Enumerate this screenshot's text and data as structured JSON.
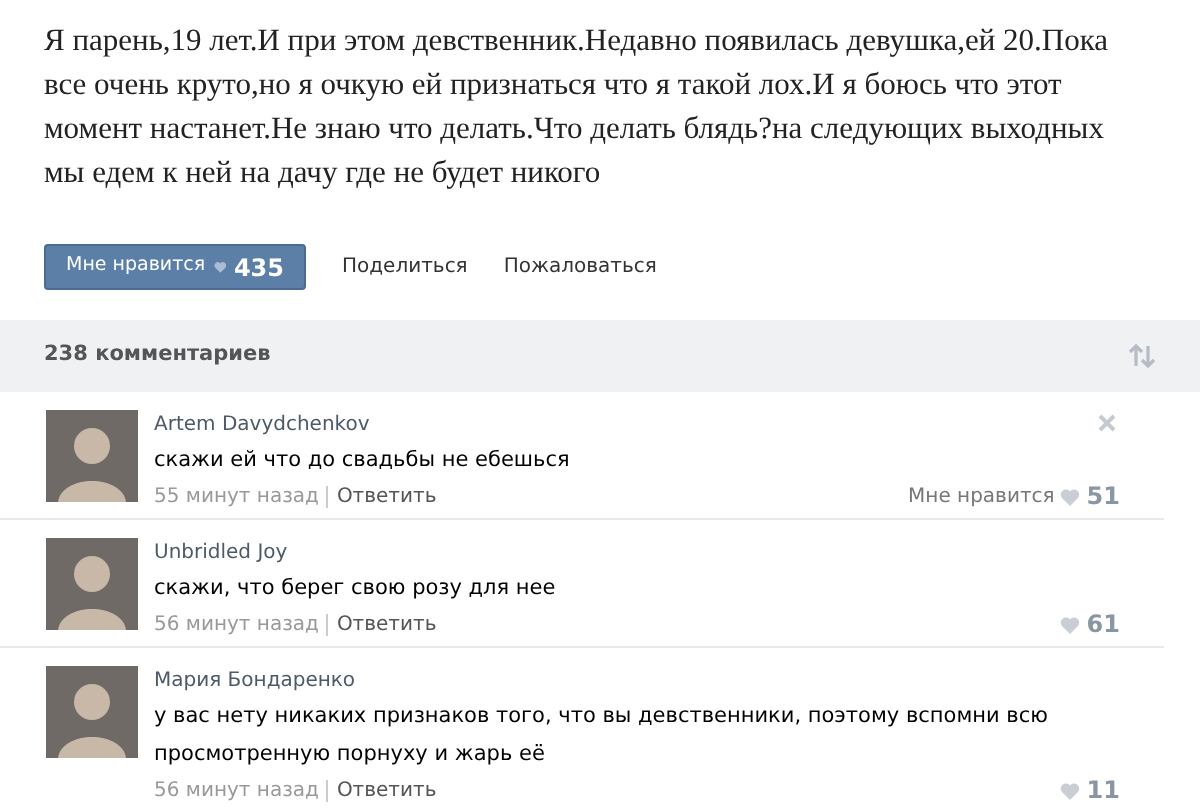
{
  "post": {
    "text": "Я парень,19 лет.И при этом девственник.Недавно появилась девушка,ей 20.Пока все очень круто,но я очкую ей признаться что я такой лох.И я боюсь что этот момент настанет.Не знаю что делать.Что делать блядь?на следующих выходных мы едем к ней на дачу где не будет никого"
  },
  "actions": {
    "like_label": "Мне нравится",
    "like_count": "435",
    "share": "Поделиться",
    "report": "Пожаловаться"
  },
  "comments_header": {
    "count": "238 комментариев"
  },
  "comments": [
    {
      "author": "Artem Davydchenkov",
      "text": "скажи ей что до свадьбы не ебешься",
      "time": "55 минут назад",
      "reply": "Ответить",
      "like_label": "Мне нравится",
      "likes": "51",
      "closable": true
    },
    {
      "author": "Unbridled Joy",
      "text": "скажи, что берег свою розу для нее",
      "time": "56 минут назад",
      "reply": "Ответить",
      "likes": "61",
      "closable": false
    },
    {
      "author": "Мария Бондаренко",
      "text": "у вас нету никаких признаков того, что вы девственники, поэтому вспомни всю просмотренную порнуху и жарь её",
      "time": "56 минут назад",
      "reply": "Ответить",
      "likes": "11",
      "closable": false
    }
  ]
}
